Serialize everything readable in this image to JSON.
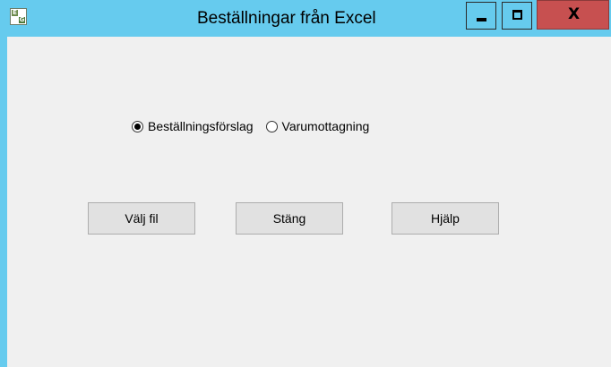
{
  "window": {
    "title": "Beställningar från Excel",
    "icon": "excel-icon",
    "controls": {
      "minimize_icon": "minimize-icon",
      "maximize_icon": "maximize-icon",
      "close_label": "X"
    },
    "colors": {
      "titlebar": "#66cbee",
      "close_button": "#c75050",
      "client_background": "#f0f0f0"
    }
  },
  "order_type": {
    "options": [
      {
        "label": "Beställningsförslag",
        "selected": true
      },
      {
        "label": "Varumottagning",
        "selected": false
      }
    ]
  },
  "buttons": {
    "choose_file": "Välj fil",
    "close": "Stäng",
    "help": "Hjälp"
  }
}
